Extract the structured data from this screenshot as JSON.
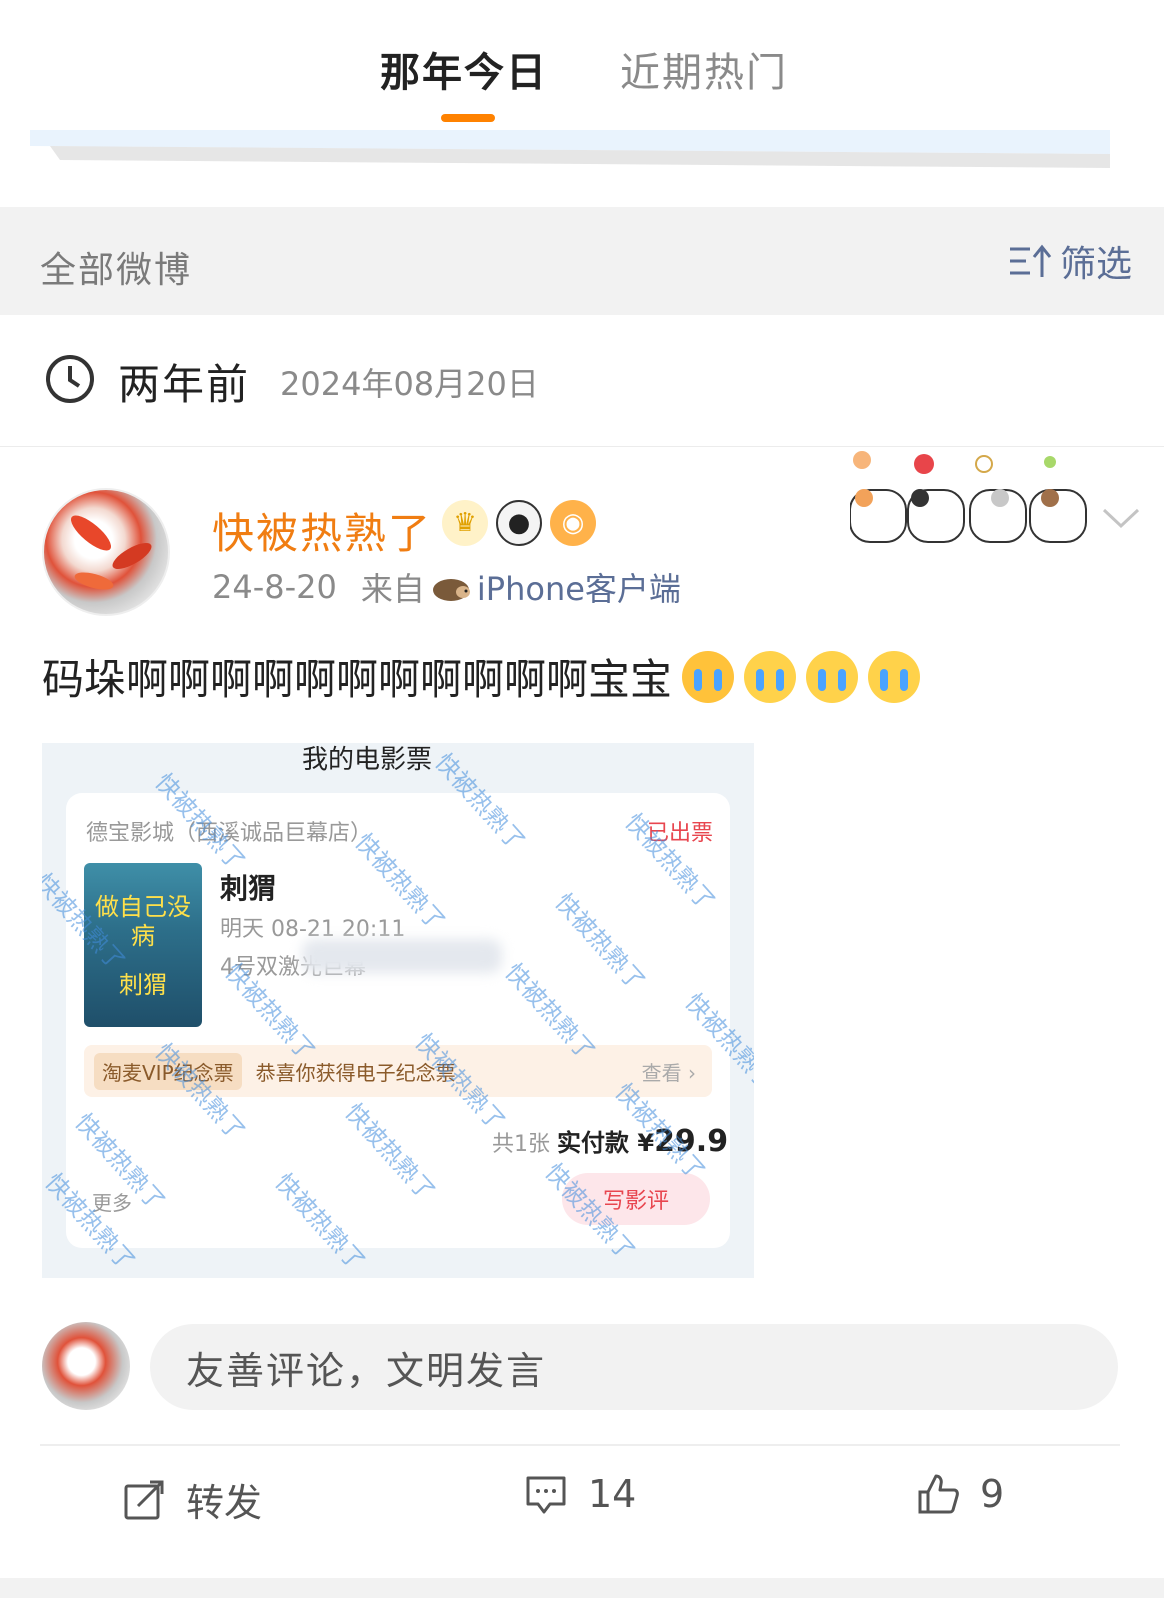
{
  "tabs": {
    "active": "那年今日",
    "inactive": "近期热门"
  },
  "filter_bar": {
    "title": "全部微博",
    "filter_label": "筛选"
  },
  "date_row": {
    "ago": "两年前",
    "date": "2024年08月20日"
  },
  "post": {
    "username": "快被热熟了",
    "time": "24-8-20",
    "from_prefix": "来自",
    "source": "iPhone客户端",
    "content": "码垛啊啊啊啊啊啊啊啊啊啊啊宝宝",
    "image": {
      "page_title": "我的电影票",
      "cinema": "德宝影城（西溪诚品巨幕店）",
      "status": "已出票",
      "poster_title": "做自己没病",
      "poster_sub": "刺猬",
      "movie": "刺猬",
      "time": "明天 08-21 20:11",
      "hall": "4号双激光巨幕",
      "vip_tag": "淘麦VIP纪念票",
      "vip_text": "恭喜你获得电子纪念票",
      "vip_more": "查看 ›",
      "pay_count": "共1张",
      "pay_label": "实付款 ¥",
      "pay_amount": "29.9",
      "review_button": "写影评",
      "more_text": "更多",
      "watermark": "快被热熟了"
    }
  },
  "comment": {
    "placeholder": "友善评论，文明发言"
  },
  "actions": {
    "repost": "转发",
    "comments": "14",
    "likes": "9"
  },
  "colors": {
    "accent_orange": "#ff8200",
    "username_orange": "#f07d12",
    "link_blue": "#5b6e96",
    "background_gray": "#f2f2f2"
  }
}
